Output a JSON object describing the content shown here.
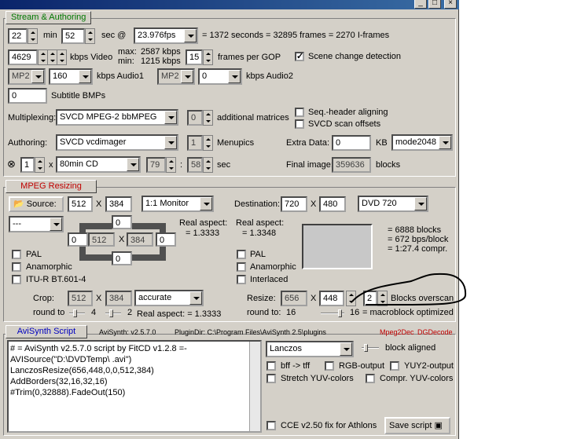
{
  "window": {
    "min_btn": "_",
    "max_btn": "□",
    "close_btn": "×"
  },
  "tabs": {
    "stream": "Stream & Authoring",
    "mpeg": "MPEG Resizing",
    "avisynth": "AviSynth Script"
  },
  "stream": {
    "duration_min": "22",
    "min_label": "min",
    "duration_sec": "52",
    "sec_label": "sec @",
    "framerate": "23.976fps",
    "summary": "= 1372 seconds = 32895 frames = 2270 I-frames",
    "video_kbps": "4629",
    "video_label": "kbps Video",
    "max_label": "max:",
    "max_value": "2587 kbps",
    "min_label2": "min:",
    "min_value": "1215 kbps",
    "gop": "15",
    "gop_label": "frames per GOP",
    "scene_change": "Scene change detection",
    "audio1_codec": "MP2",
    "audio1_kbps": "160",
    "audio1_label": "kbps Audio1",
    "audio2_codec": "MP2",
    "audio2_kbps": "0",
    "audio2_label": "kbps Audio2",
    "subtitle_count": "0",
    "subtitle_label": "Subtitle BMPs",
    "mux_label": "Multiplexing:",
    "mux_value": "SVCD MPEG-2 bbMPEG",
    "matrices": "0",
    "matrices_label": "additional matrices",
    "seq_header": "Seq.-header aligning",
    "svcd_scan": "SVCD scan offsets",
    "authoring_label": "Authoring:",
    "authoring_value": "SVCD vcdimager",
    "menupics": "1",
    "menupics_label": "Menupics",
    "extra_label": "Extra Data:",
    "extra_value": "0",
    "kb_label": "KB",
    "mode_value": "mode2048",
    "disc_count": "1",
    "x_label": "x",
    "disc_type": "80min CD",
    "disc_min": "79",
    "colon": ":",
    "disc_sec": "58",
    "sec_label2": "sec",
    "final_label": "Final image:",
    "final_value": "359636",
    "blocks_label": "blocks"
  },
  "mpeg": {
    "source_label": "Source:",
    "src_w": "512",
    "src_x": "X",
    "src_h": "384",
    "monitor": "1:1 Monitor",
    "dest_label": "Destination:",
    "dst_w": "720",
    "dst_x": "X",
    "dst_h": "480",
    "dvd": "DVD 720",
    "aspect_combo": "---",
    "border_top": "0",
    "border_left": "0",
    "inner_w": "512",
    "inner_x": "X",
    "inner_h": "384",
    "border_right": "0",
    "border_bottom": "0",
    "real_aspect_l": "Real aspect:",
    "real_aspect_l_val": "= 1.3333",
    "real_aspect_r": "Real aspect:",
    "real_aspect_r_val": "= 1.3348",
    "blocks1": "= 6888 blocks",
    "blocks2": "= 672 bps/block",
    "blocks3": "= 1:27.4 compr.",
    "pal_l": "PAL",
    "anamorphic_l": "Anamorphic",
    "itur": "ITU-R BT.601-4",
    "pal_r": "PAL",
    "anamorphic_r": "Anamorphic",
    "interlaced": "Interlaced",
    "crop_label": "Crop:",
    "crop_w": "512",
    "crop_x": "X",
    "crop_h": "384",
    "crop_mode": "accurate",
    "roundto_label": "round to",
    "round_a": "4",
    "round_b": "2",
    "real_aspect_c": "Real aspect: = 1.3333",
    "resize_label": "Resize:",
    "res_w": "656",
    "res_x": "X",
    "res_h": "448",
    "overscan_val": "2",
    "overscan_label": "Blocks overscan",
    "roundto_label2": "round to:",
    "round_c": "16",
    "round_d": "16",
    "macroblock": "= macroblock optimized"
  },
  "avisynth": {
    "version": "AviSynth: v2.5.7.0",
    "plugin_dir": "PluginDir:  C:\\Program Files\\AviSynth 2.5\\plugins",
    "mpeg2dec": "Mpeg2Dec",
    "dgdecode": "DGDecode",
    "script_lines": [
      "# = AviSynth v2.5.7.0 script by FitCD v1.2.8 =-",
      "AVISource(\"D:\\DVDTemp\\              .avi\")",
      "LanczosResize(656,448,0,0,512,384)",
      "AddBorders(32,16,32,16)",
      "#Trim(0,32888).FadeOut(150)"
    ],
    "resizer": "Lanczos",
    "block_aligned": "block aligned",
    "bff": "bff -> tff",
    "rgb_output": "RGB-output",
    "yuy2_output": "YUY2-output",
    "stretch_yuv": "Stretch YUV-colors",
    "compr_yuv": "Compr. YUV-colors",
    "cce_fix": "CCE v2.50 fix for Athlons",
    "save_script": "Save script"
  }
}
